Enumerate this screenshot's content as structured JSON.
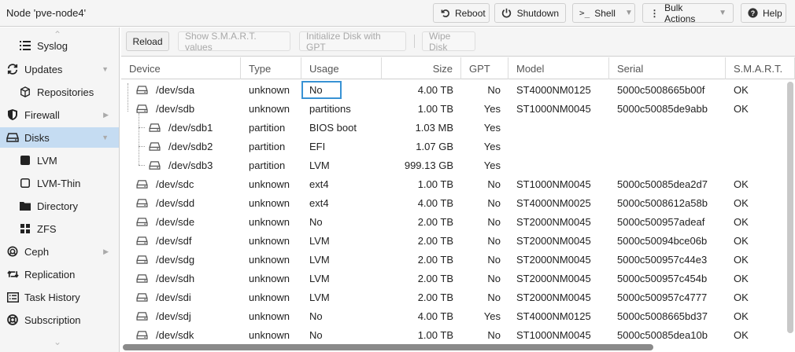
{
  "header": {
    "title": "Node 'pve-node4'",
    "buttons": {
      "reboot": "Reboot",
      "shutdown": "Shutdown",
      "shell": "Shell",
      "bulk": "Bulk Actions",
      "help": "Help"
    }
  },
  "sidebar": {
    "items": [
      {
        "label": "Syslog",
        "icon": "list-icon"
      },
      {
        "label": "Updates",
        "icon": "refresh-icon"
      },
      {
        "label": "Repositories",
        "icon": "package-icon"
      },
      {
        "label": "Firewall",
        "icon": "shield-icon"
      },
      {
        "label": "Disks",
        "icon": "disk-icon"
      },
      {
        "label": "LVM",
        "icon": "square-icon"
      },
      {
        "label": "LVM-Thin",
        "icon": "square-outline-icon"
      },
      {
        "label": "Directory",
        "icon": "folder-icon"
      },
      {
        "label": "ZFS",
        "icon": "grid-icon"
      },
      {
        "label": "Ceph",
        "icon": "ceph-icon"
      },
      {
        "label": "Replication",
        "icon": "retweet-icon"
      },
      {
        "label": "Task History",
        "icon": "list-alt-icon"
      },
      {
        "label": "Subscription",
        "icon": "support-icon"
      }
    ]
  },
  "toolbar": {
    "reload": "Reload",
    "smart": "Show S.M.A.R.T. values",
    "init_gpt": "Initialize Disk with GPT",
    "wipe": "Wipe Disk"
  },
  "columns": {
    "device": "Device",
    "type": "Type",
    "usage": "Usage",
    "size": "Size",
    "gpt": "GPT",
    "model": "Model",
    "serial": "Serial",
    "smart": "S.M.A.R.T."
  },
  "rows": [
    {
      "device": "/dev/sda",
      "type": "unknown",
      "usage": "No",
      "size": "4.00 TB",
      "gpt": "No",
      "model": "ST4000NM0125",
      "serial": "5000c5008665b00f",
      "smart": "OK"
    },
    {
      "device": "/dev/sdb",
      "type": "unknown",
      "usage": "partitions",
      "size": "1.00 TB",
      "gpt": "Yes",
      "model": "ST1000NM0045",
      "serial": "5000c50085de9abb",
      "smart": "OK"
    },
    {
      "device": "/dev/sdb1",
      "type": "partition",
      "usage": "BIOS boot",
      "size": "1.03 MB",
      "gpt": "Yes",
      "model": "",
      "serial": "",
      "smart": ""
    },
    {
      "device": "/dev/sdb2",
      "type": "partition",
      "usage": "EFI",
      "size": "1.07 GB",
      "gpt": "Yes",
      "model": "",
      "serial": "",
      "smart": ""
    },
    {
      "device": "/dev/sdb3",
      "type": "partition",
      "usage": "LVM",
      "size": "999.13 GB",
      "gpt": "Yes",
      "model": "",
      "serial": "",
      "smart": ""
    },
    {
      "device": "/dev/sdc",
      "type": "unknown",
      "usage": "ext4",
      "size": "1.00 TB",
      "gpt": "No",
      "model": "ST1000NM0045",
      "serial": "5000c50085dea2d7",
      "smart": "OK"
    },
    {
      "device": "/dev/sdd",
      "type": "unknown",
      "usage": "ext4",
      "size": "4.00 TB",
      "gpt": "No",
      "model": "ST4000NM0025",
      "serial": "5000c5008612a58b",
      "smart": "OK"
    },
    {
      "device": "/dev/sde",
      "type": "unknown",
      "usage": "No",
      "size": "2.00 TB",
      "gpt": "No",
      "model": "ST2000NM0045",
      "serial": "5000c500957adeaf",
      "smart": "OK"
    },
    {
      "device": "/dev/sdf",
      "type": "unknown",
      "usage": "LVM",
      "size": "2.00 TB",
      "gpt": "No",
      "model": "ST2000NM0045",
      "serial": "5000c50094bce06b",
      "smart": "OK"
    },
    {
      "device": "/dev/sdg",
      "type": "unknown",
      "usage": "LVM",
      "size": "2.00 TB",
      "gpt": "No",
      "model": "ST2000NM0045",
      "serial": "5000c500957c44e3",
      "smart": "OK"
    },
    {
      "device": "/dev/sdh",
      "type": "unknown",
      "usage": "LVM",
      "size": "2.00 TB",
      "gpt": "No",
      "model": "ST2000NM0045",
      "serial": "5000c500957c454b",
      "smart": "OK"
    },
    {
      "device": "/dev/sdi",
      "type": "unknown",
      "usage": "LVM",
      "size": "2.00 TB",
      "gpt": "No",
      "model": "ST2000NM0045",
      "serial": "5000c500957c4777",
      "smart": "OK"
    },
    {
      "device": "/dev/sdj",
      "type": "unknown",
      "usage": "No",
      "size": "4.00 TB",
      "gpt": "Yes",
      "model": "ST4000NM0125",
      "serial": "5000c5008665bd37",
      "smart": "OK"
    },
    {
      "device": "/dev/sdk",
      "type": "unknown",
      "usage": "No",
      "size": "1.00 TB",
      "gpt": "No",
      "model": "ST1000NM0045",
      "serial": "5000c50085dea10b",
      "smart": "OK"
    }
  ],
  "colors": {
    "accent": "#3892d4",
    "selected": "#c5dcf2"
  }
}
